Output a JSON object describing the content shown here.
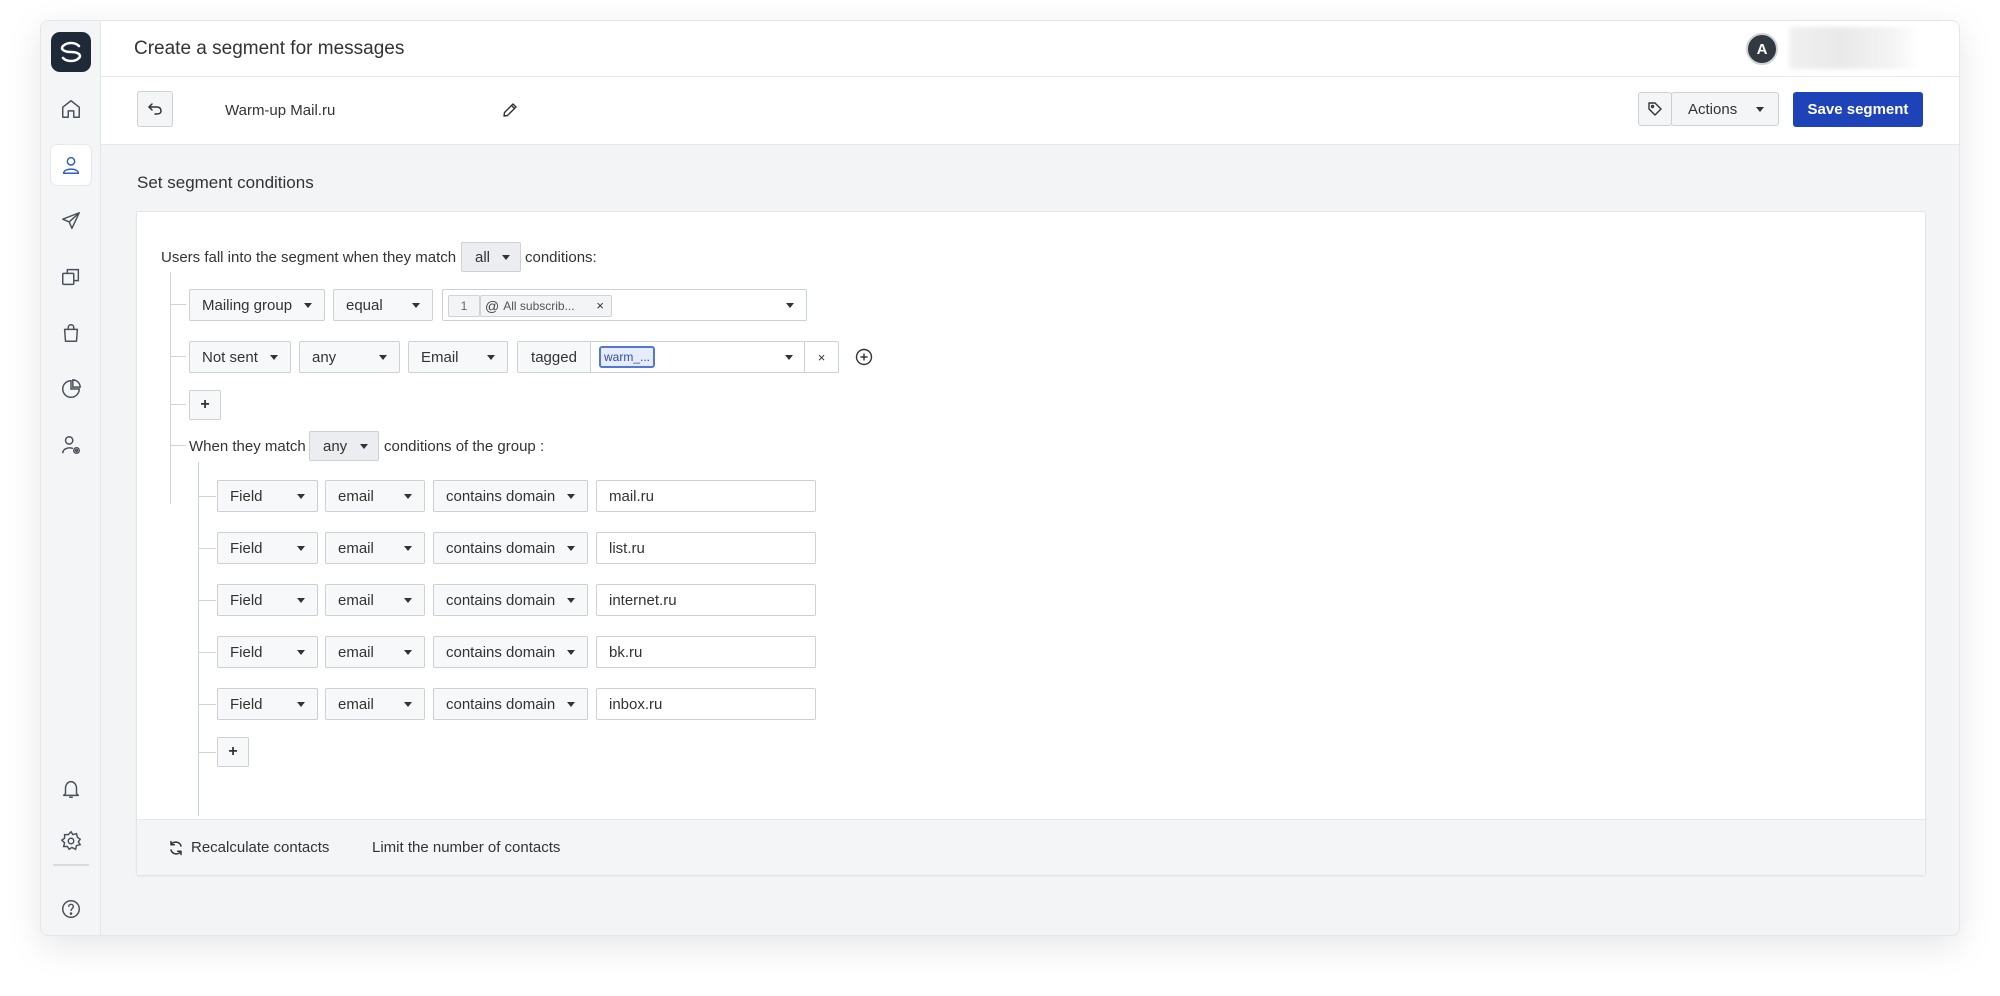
{
  "header": {
    "title": "Create a segment for messages",
    "avatar_initial": "A"
  },
  "sidebar": {
    "items": [
      {
        "icon": "home-icon"
      },
      {
        "icon": "users-icon",
        "active": true
      },
      {
        "icon": "send-icon"
      },
      {
        "icon": "templates-icon"
      },
      {
        "icon": "shopping-bag-icon"
      },
      {
        "icon": "analytics-icon"
      },
      {
        "icon": "user-settings-icon"
      },
      {
        "icon": "bell-icon"
      },
      {
        "icon": "gear-icon"
      },
      {
        "icon": "help-icon"
      }
    ]
  },
  "toolbar": {
    "segment_name": "Warm-up Mail.ru",
    "actions_label": "Actions",
    "save_label": "Save segment"
  },
  "section_title": "Set segment conditions",
  "conditions": {
    "intro_prefix": "Users fall into the segment when they match",
    "match_value": "all",
    "intro_suffix": "conditions:",
    "row1": {
      "field": "Mailing group",
      "operator": "equal",
      "chip_count": "1",
      "chip_label": "All subscrib..."
    },
    "row2": {
      "field": "Not sent",
      "quantifier": "any",
      "channel": "Email",
      "tagged_label": "tagged",
      "tag_chip": "warm_..."
    },
    "add_label": "+",
    "group": {
      "prefix": "When they match",
      "match_value": "any",
      "suffix": "conditions of the group :",
      "rows": [
        {
          "type": "Field",
          "field": "email",
          "operator": "contains domain",
          "value": "mail.ru"
        },
        {
          "type": "Field",
          "field": "email",
          "operator": "contains domain",
          "value": "list.ru"
        },
        {
          "type": "Field",
          "field": "email",
          "operator": "contains domain",
          "value": "internet.ru"
        },
        {
          "type": "Field",
          "field": "email",
          "operator": "contains domain",
          "value": "bk.ru"
        },
        {
          "type": "Field",
          "field": "email",
          "operator": "contains domain",
          "value": "inbox.ru"
        }
      ],
      "add_label": "+"
    }
  },
  "footer": {
    "recalculate_label": "Recalculate contacts",
    "limit_label": "Limit the number of contacts"
  },
  "colors": {
    "primary": "#1e42b8",
    "sidebar_icon": "#4a5059",
    "active_icon": "#2f5ec4"
  }
}
